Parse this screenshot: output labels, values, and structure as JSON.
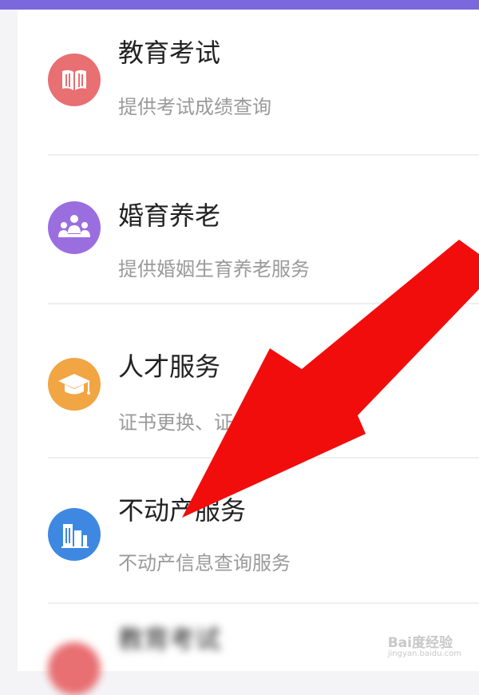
{
  "colors": {
    "top_bar": "#7b68dd",
    "education_icon": "#e86f72",
    "marriage_icon": "#9b6ee0",
    "talent_icon": "#f2a543",
    "realestate_icon": "#3e88e2",
    "arrow": "#f20d0d"
  },
  "services": [
    {
      "title": "教育考试",
      "desc": "提供考试成绩查询",
      "icon": "book-icon"
    },
    {
      "title": "婚育养老",
      "desc": "提供婚姻生育养老服务",
      "icon": "family-icon"
    },
    {
      "title": "人才服务",
      "desc": "证书更换、证",
      "icon": "graduation-cap-icon"
    },
    {
      "title": "不动产服务",
      "desc": "不动产信息查询服务",
      "icon": "building-icon"
    },
    {
      "title": "教育考试",
      "icon": "book-icon"
    }
  ],
  "watermark": {
    "brand": "Bai度经验",
    "url": "jingyan.baidu.com"
  }
}
